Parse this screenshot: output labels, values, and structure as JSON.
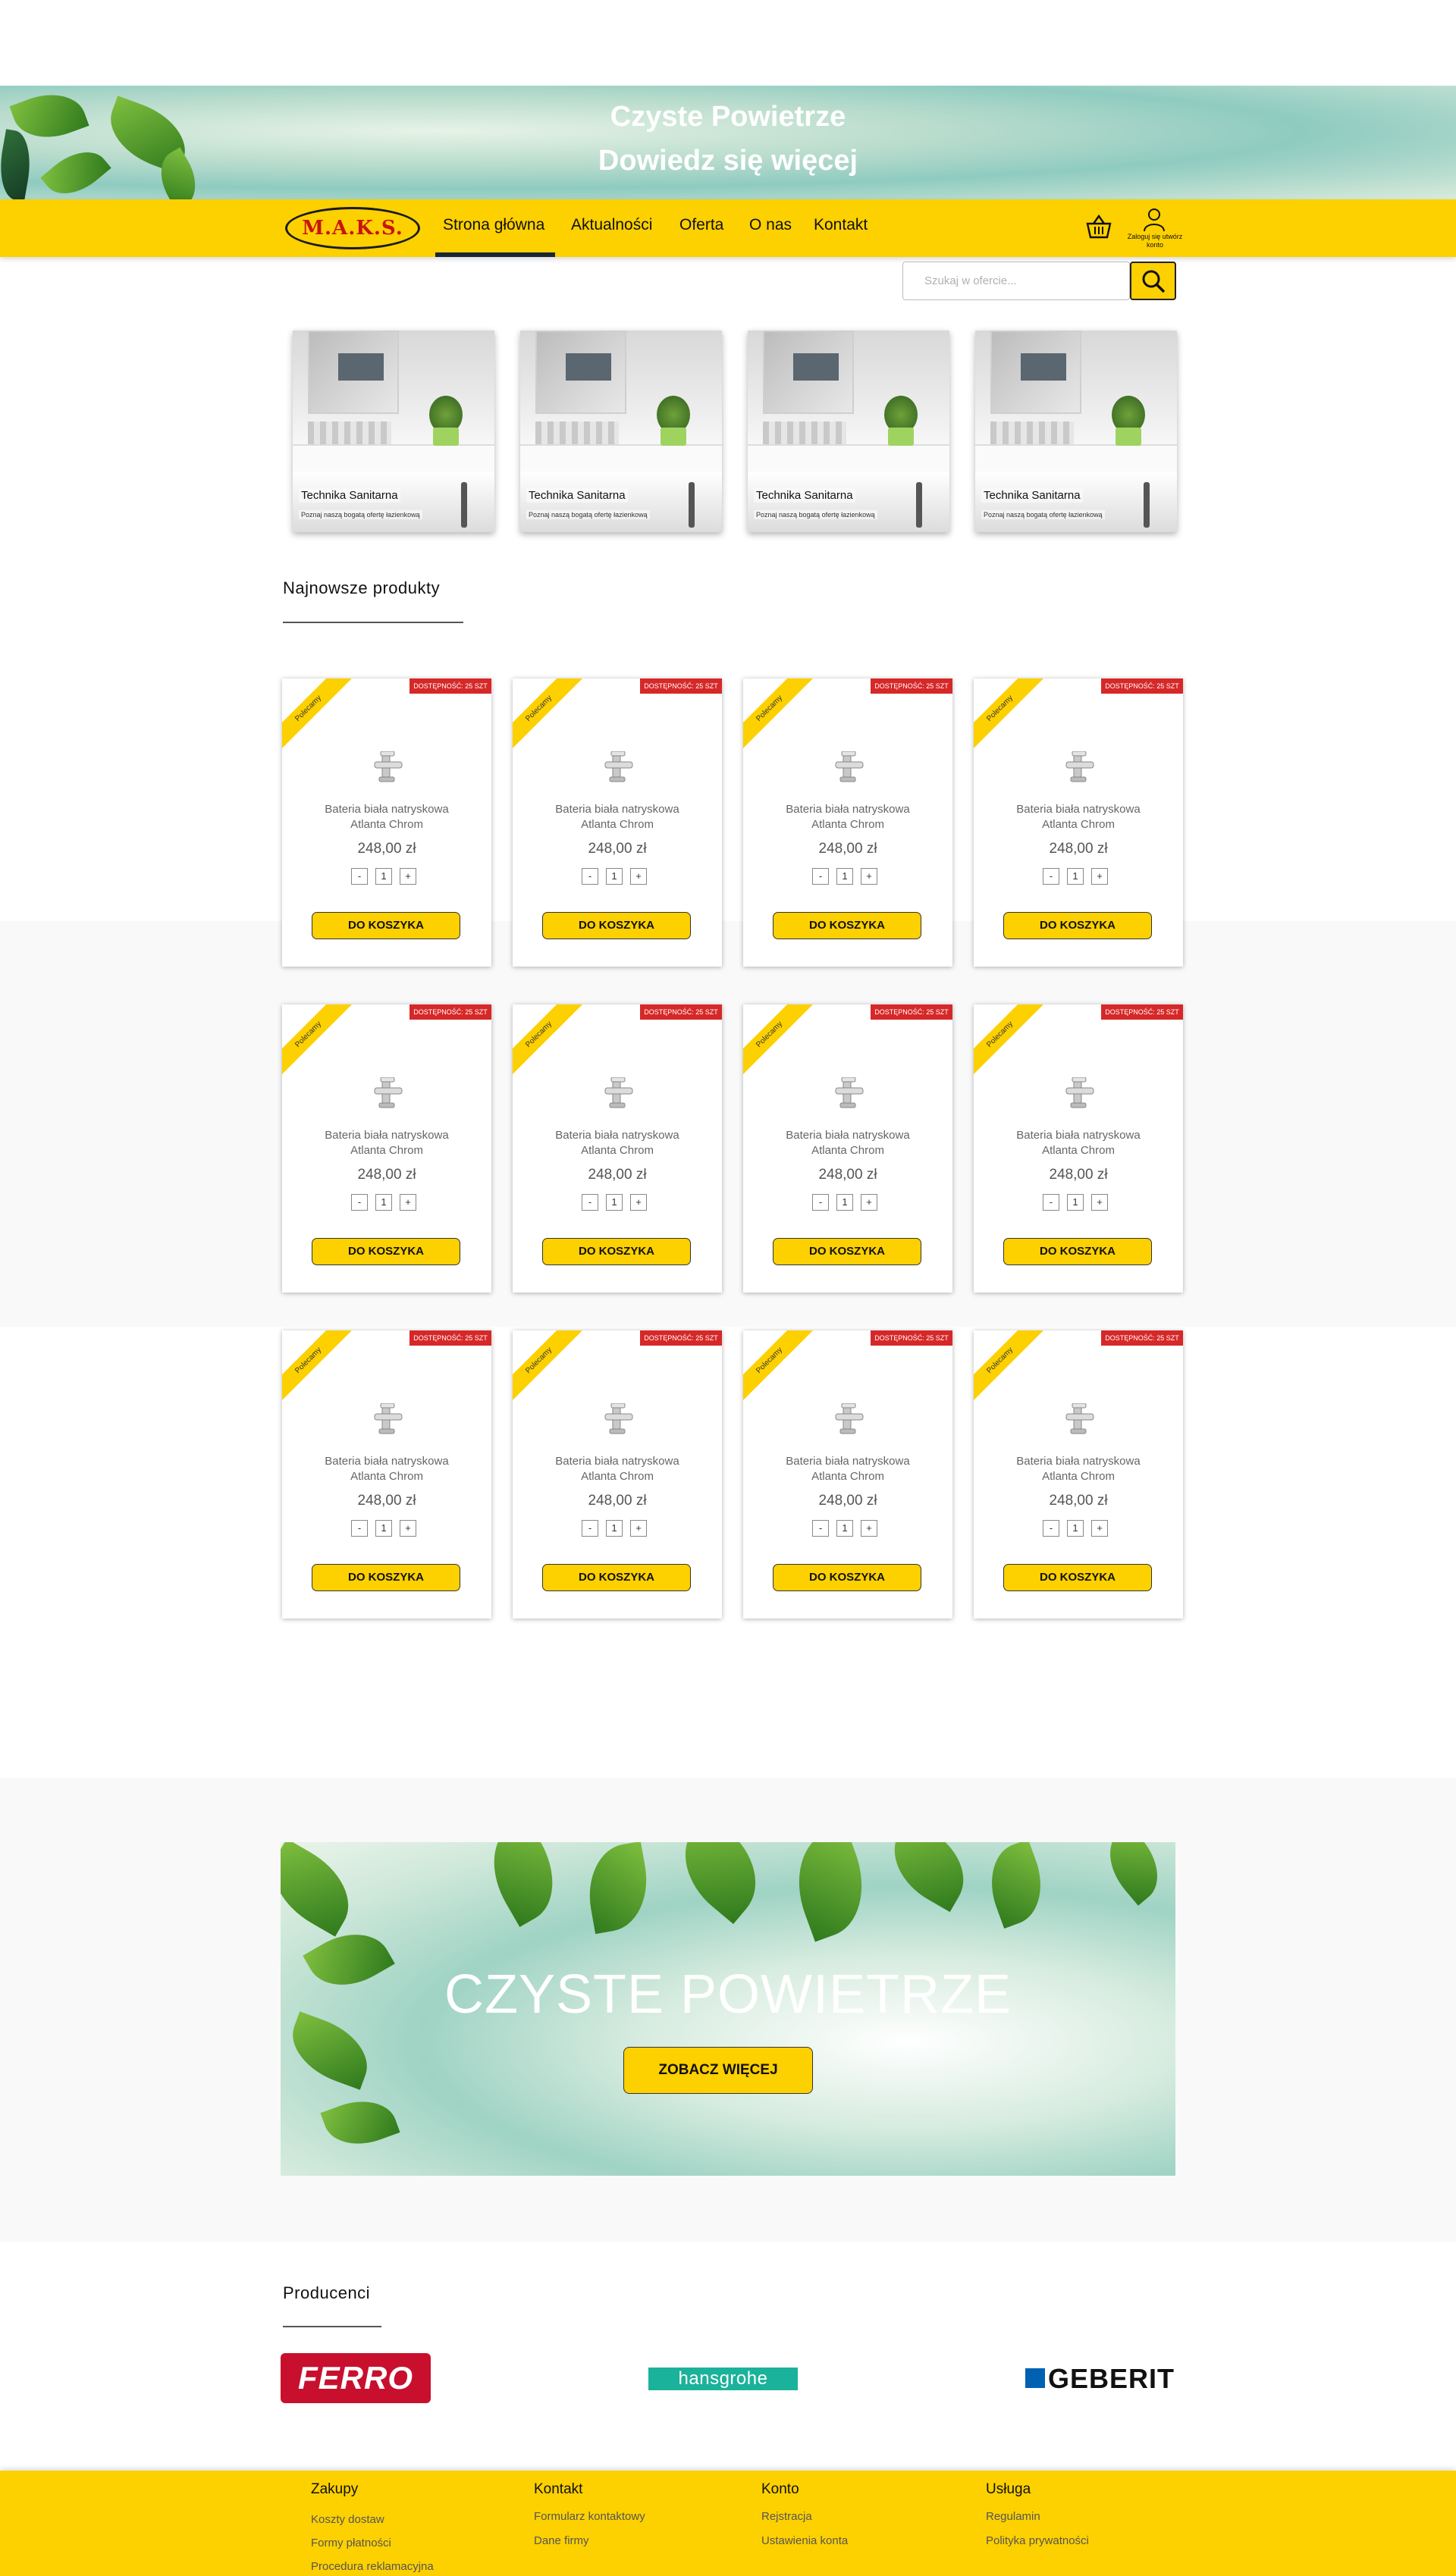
{
  "hero": {
    "line1": "Czyste Powietrze",
    "line2": "Dowiedz się więcej"
  },
  "logo": {
    "text": "M.A.K.S."
  },
  "nav": {
    "items": [
      "Strona główna",
      "Aktualności",
      "Oferta",
      "O nas",
      "Kontakt"
    ],
    "active": "Strona główna",
    "account": "Zaloguj się utwórz konto"
  },
  "search": {
    "placeholder": "Szukaj w ofercie..."
  },
  "categories": [
    {
      "title": "Technika Sanitarna",
      "subtitle": "Poznaj naszą bogatą ofertę łazienkową"
    },
    {
      "title": "Technika Sanitarna",
      "subtitle": "Poznaj naszą bogatą ofertę łazienkową"
    },
    {
      "title": "Technika Sanitarna",
      "subtitle": "Poznaj naszą bogatą ofertę łazienkową"
    },
    {
      "title": "Technika Sanitarna",
      "subtitle": "Poznaj naszą bogatą ofertę łazienkową"
    }
  ],
  "newest": {
    "title": "Najnowsze produkty",
    "product": {
      "ribbon": "Polecamy",
      "availability": "DOSTĘPNOŚĆ: 25 SZT",
      "name_line1": "Bateria biała natryskowa",
      "name_line2": "Atlanta Chrom",
      "price": "248,00 zł",
      "qty_minus": "-",
      "qty_value": "1",
      "qty_plus": "+",
      "button": "DO KOSZYKA"
    }
  },
  "banner": {
    "title": "CZYSTE POWIETRZE",
    "button": "ZOBACZ WIĘCEJ"
  },
  "producers": {
    "title": "Producenci",
    "brands": [
      "FERRO",
      "hansgrohe",
      "GEBERIT"
    ]
  },
  "footer": {
    "columns": [
      {
        "title": "Zakupy",
        "links": [
          "Koszty dostaw",
          "Formy płatności",
          "Procedura reklamacyjna"
        ]
      },
      {
        "title": "Kontakt",
        "links": [
          "Formularz kontaktowy",
          "Dane firmy"
        ]
      },
      {
        "title": "Konto",
        "links": [
          "Rejstracja",
          "Ustawienia konta"
        ]
      },
      {
        "title": "Usługa",
        "links": [
          "Regulamin",
          "Polityka prywatności"
        ]
      }
    ]
  },
  "colors": {
    "brand_yellow": "#fdd000",
    "badge_red": "#d62828",
    "nav_dark": "#1a2633"
  }
}
